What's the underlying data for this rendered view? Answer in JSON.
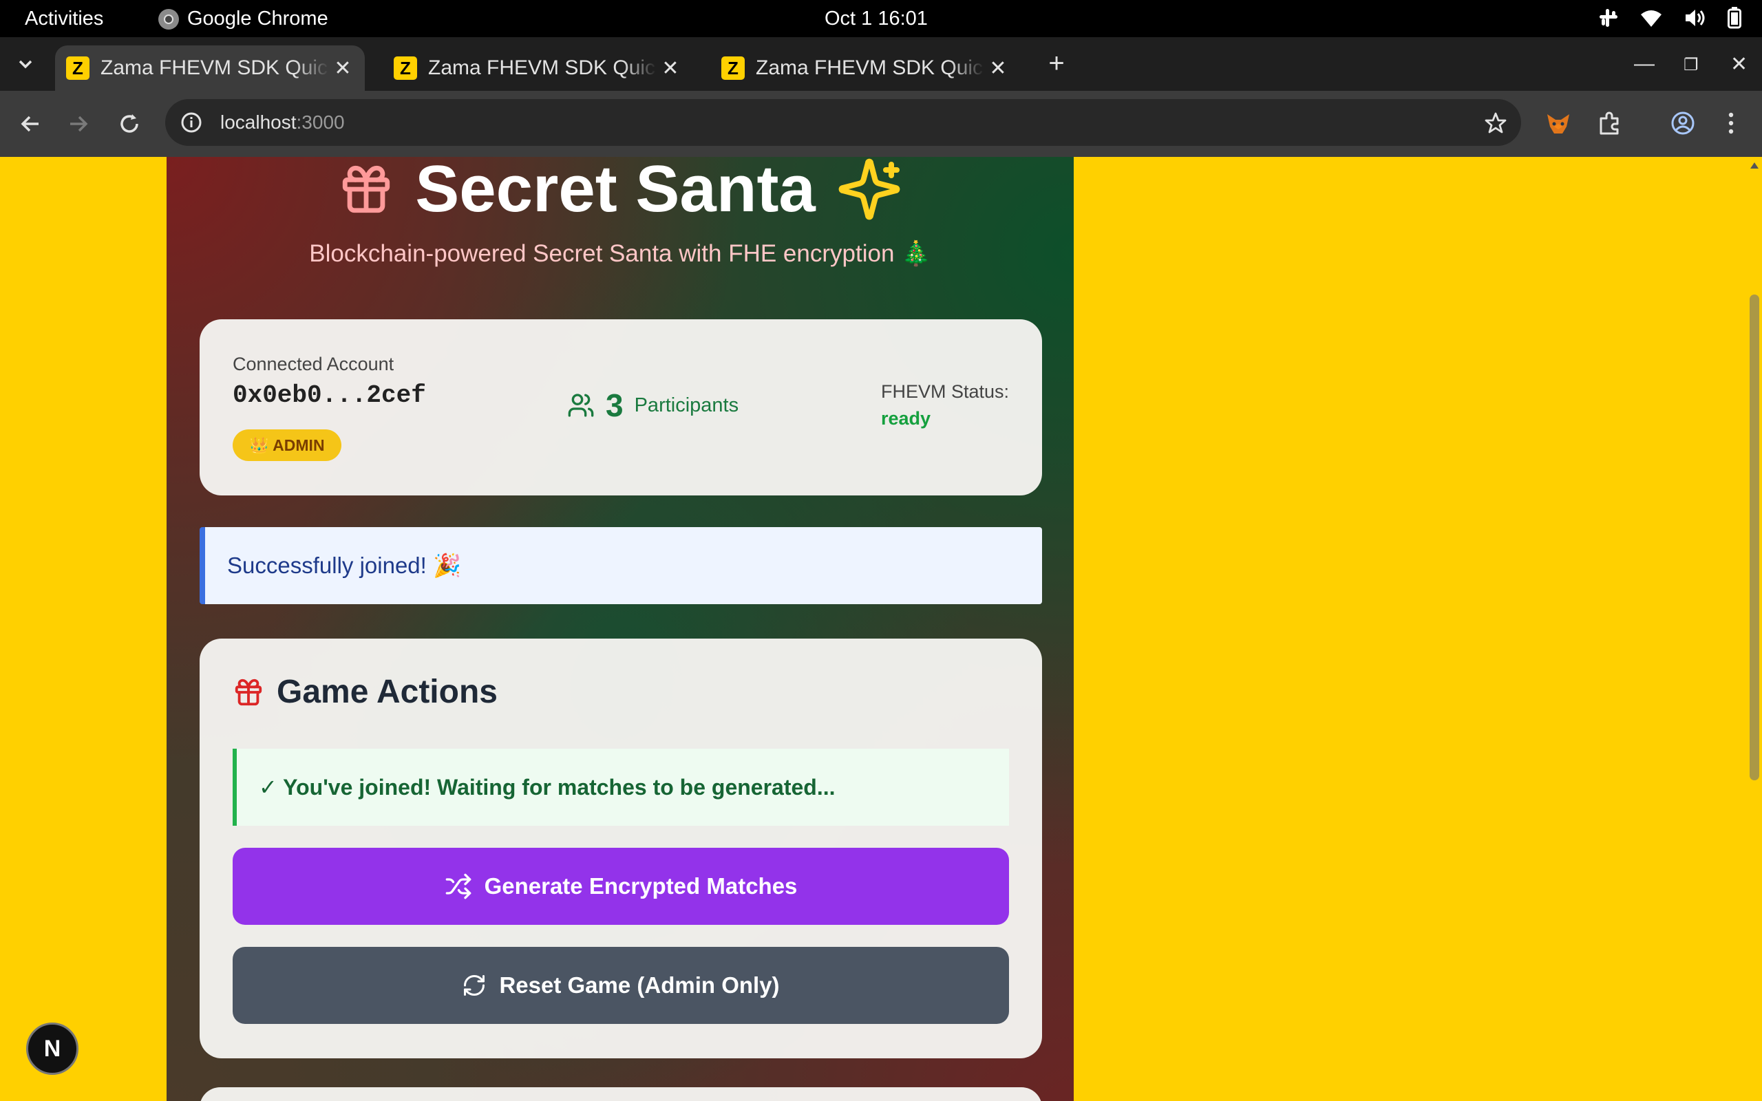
{
  "system_bar": {
    "activities": "Activities",
    "app_name": "Google Chrome",
    "clock": "Oct 1  16:01"
  },
  "browser": {
    "tabs": [
      {
        "title": "Zama FHEVM SDK Quickstart",
        "active": true
      },
      {
        "title": "Zama FHEVM SDK Quickstart",
        "active": false
      },
      {
        "title": "Zama FHEVM SDK Quickstart",
        "active": false
      }
    ],
    "url_host": "localhost",
    "url_port": ":3000"
  },
  "page": {
    "title": "Secret Santa",
    "subtitle": "Blockchain-powered Secret Santa with FHE encryption 🎄",
    "account": {
      "label": "Connected Account",
      "address": "0x0eb0...2cef",
      "badge": "👑 ADMIN",
      "participants_count": "3",
      "participants_label": "Participants",
      "status_label": "FHEVM Status:",
      "status_value": "ready"
    },
    "notice": "Successfully joined! 🎉",
    "actions": {
      "title": "Game Actions",
      "joined_message": "✓ You've joined! Waiting for matches to be generated...",
      "generate_button": "Generate Encrypted Matches",
      "reset_button": "Reset Game (Admin Only)"
    }
  },
  "overlay": {
    "next_badge": "N"
  },
  "colors": {
    "page_background": "#ffd000",
    "accent_purple": "#9333ea",
    "reset_gray": "#4b5563",
    "status_green": "#15a03e",
    "admin_badge": "#f5c518"
  }
}
